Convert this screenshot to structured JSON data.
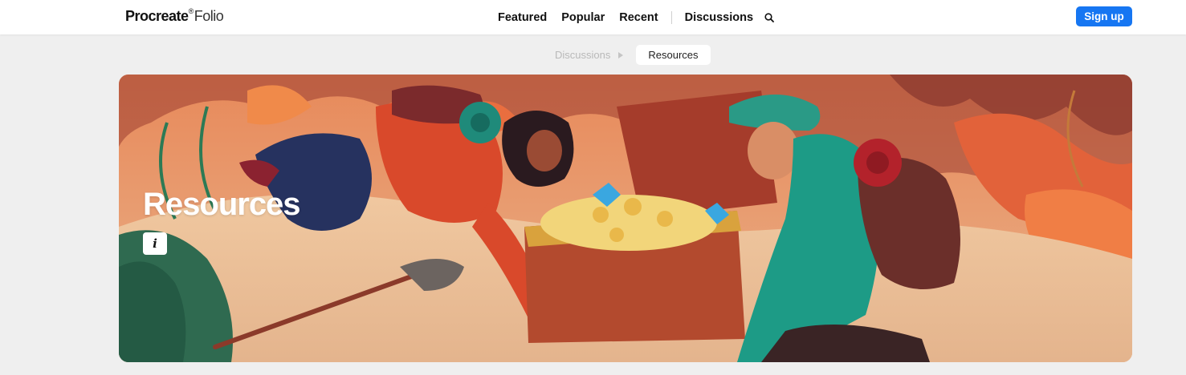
{
  "header": {
    "logo": {
      "brand": "Procreate",
      "registered": "®",
      "product": "Folio"
    },
    "nav": [
      {
        "label": "Featured"
      },
      {
        "label": "Popular"
      },
      {
        "label": "Recent"
      },
      {
        "label": "Discussions"
      }
    ],
    "search_icon": "search-icon",
    "signup_label": "Sign up"
  },
  "breadcrumb": {
    "parent": "Discussions",
    "current": "Resources"
  },
  "hero": {
    "title": "Resources",
    "info_label": "i"
  },
  "colors": {
    "accent": "#1676f2",
    "page_background": "#efefef",
    "hero_background": "#e9a477"
  }
}
